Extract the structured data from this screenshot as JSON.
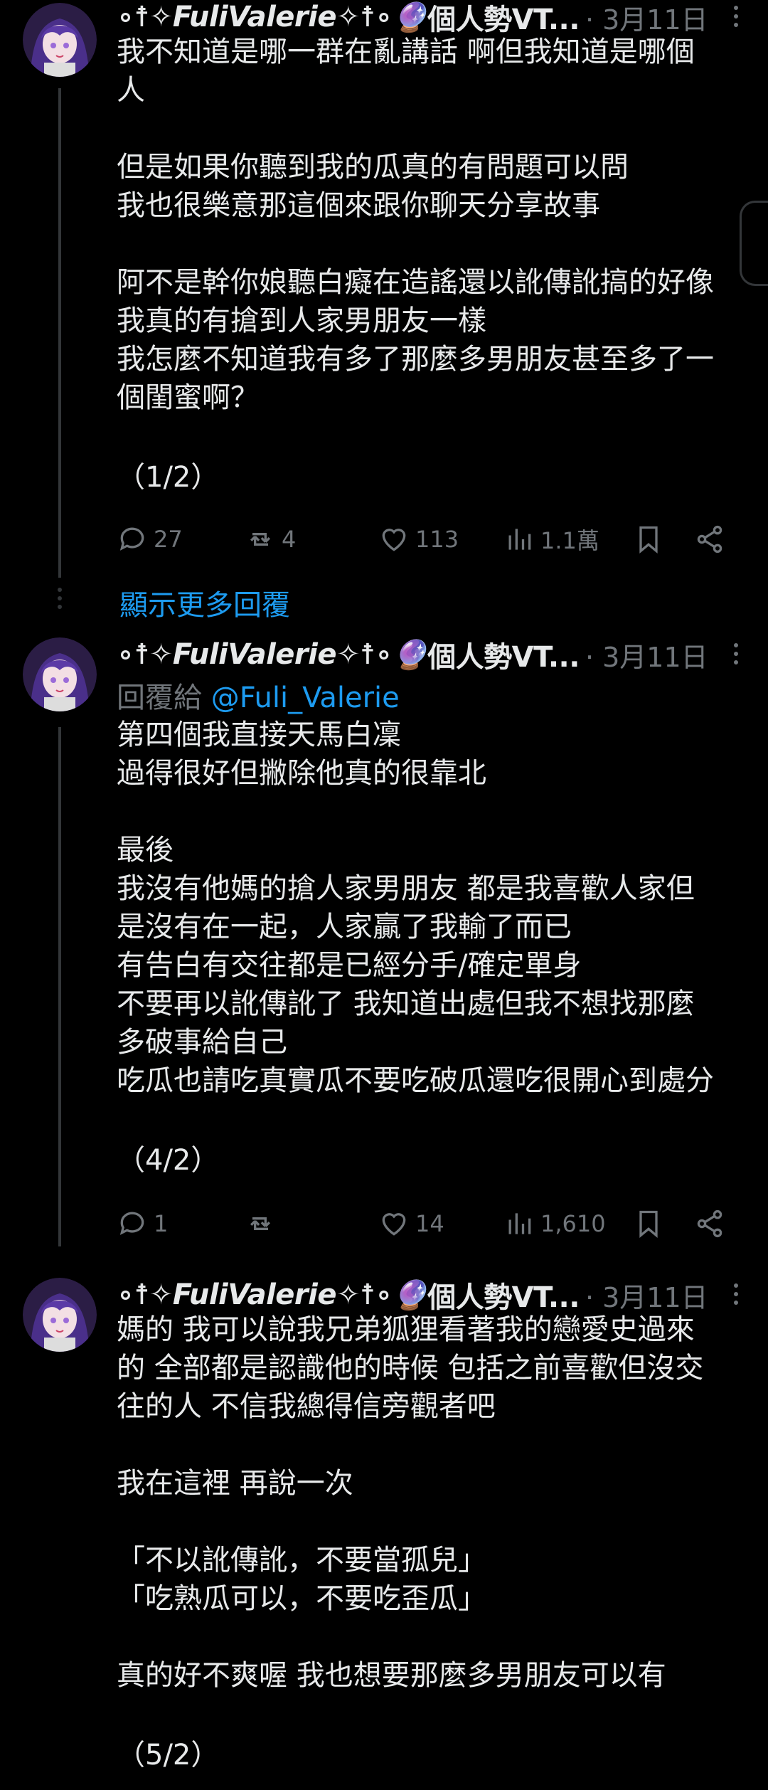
{
  "posts": [
    {
      "author": "∘☨✧FuliValerie✧☨∘",
      "emoji": "🔮",
      "suffix": "個人勢VT...",
      "date": "· 3月11日",
      "lines": [
        "我不知道是哪一群在亂講話 啊但我知道是哪個",
        "人",
        "",
        "但是如果你聽到我的瓜真的有問題可以問",
        "我也很樂意那這個來跟你聊天分享故事",
        "",
        "阿不是幹你娘聽白癡在造謠還以訛傳訛搞的好像",
        "我真的有搶到人家男朋友一樣",
        "我怎麼不知道我有多了那麼多男朋友甚至多了一",
        "個閨蜜啊？",
        "",
        "（1/2）"
      ],
      "stats": {
        "replies": "27",
        "reposts": "4",
        "likes": "113",
        "views": "1.1萬"
      }
    },
    {
      "author": "∘☨✧FuliValerie✧☨∘",
      "emoji": "🔮",
      "suffix": "個人勢VT...",
      "date": "· 3月11日",
      "reply_prefix": "回覆給 ",
      "reply_handle": "@Fuli_Valerie",
      "lines": [
        "第四個我直接天馬白凜",
        "過得很好但撇除他真的很靠北",
        "",
        "最後",
        "我沒有他媽的搶人家男朋友 都是我喜歡人家但",
        "是沒有在一起，人家贏了我輸了而已",
        "有告白有交往都是已經分手/確定單身",
        "不要再以訛傳訛了 我知道出處但我不想找那麼",
        "多破事給自己",
        "吃瓜也請吃真實瓜不要吃破瓜還吃很開心到處分",
        "",
        "（4/2）"
      ],
      "stats": {
        "replies": "1",
        "reposts": "",
        "likes": "14",
        "views": "1,610"
      }
    },
    {
      "author": "∘☨✧FuliValerie✧☨∘",
      "emoji": "🔮",
      "suffix": "個人勢VT...",
      "date": "· 3月11日",
      "lines": [
        "媽的 我可以說我兄弟狐狸看著我的戀愛史過來",
        "的 全部都是認識他的時候 包括之前喜歡但沒交",
        "往的人 不信我總得信旁觀者吧",
        "",
        "我在這裡 再說一次",
        "",
        "「不以訛傳訛，不要當孤兒」",
        "「吃熟瓜可以，不要吃歪瓜」",
        "",
        "真的好不爽喔 我也想要那麼多男朋友可以有",
        "",
        "（5/2）"
      ]
    }
  ],
  "show_more": "顯示更多回覆",
  "colors": {
    "accent": "#1d9bf0",
    "muted": "#71767b",
    "text": "#e7e9ea",
    "bg": "#000000"
  }
}
